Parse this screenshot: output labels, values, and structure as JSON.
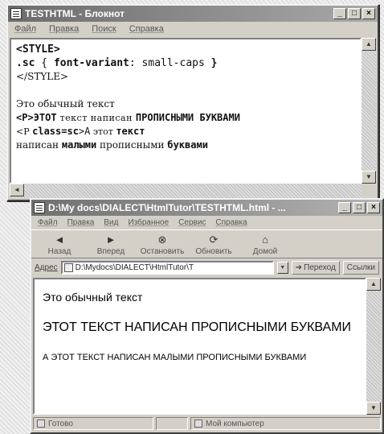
{
  "notepad": {
    "title": "TESTHTML - Блокнот",
    "menu": [
      "Файл",
      "Правка",
      "Поиск",
      "Справка"
    ],
    "lines": [
      "<STYLE>",
      ".sc { font-variant: small-caps }",
      "</STYLE>",
      "Это обычный текст",
      "<P>ЭТОТ текст нaписан ПРОПИСНЫМИ БУКВАМИ",
      "<P class=sc>А этот текст",
      "написан малыми прописными буквами"
    ],
    "line2_parts": {
      "sel": ".sc",
      "open": " { ",
      "prop": "font-variant",
      "colon": ": small-caps ",
      "close": "}"
    },
    "line5_parts": {
      "tag": "<P>",
      "bold": "ЭТОТ",
      "mid": " текст нaписан ",
      "caps": "ПРОПИСНЫМИ БУКВАМИ"
    },
    "line6_parts": {
      "tag": "<P ",
      "cls": "class=sc",
      "rest": ">А",
      "mid": " этот ",
      "bold": "текст"
    },
    "line7_parts": {
      "a": "написан ",
      "b": "малыми",
      "c": " прописными ",
      "d": "буквами"
    }
  },
  "ie": {
    "title": "D:\\My docs\\DIALECT\\HtmlTutor\\TESTHTML.html - ...",
    "menu": [
      "Файл",
      "Правка",
      "Вид",
      "Избранное",
      "Сервис",
      "Справка"
    ],
    "toolbar": [
      {
        "label": "Назад",
        "icon": "back-arrow-icon",
        "glyph": "◄"
      },
      {
        "label": "Вперед",
        "icon": "forward-arrow-icon",
        "glyph": "►"
      },
      {
        "label": "Остановить",
        "icon": "stop-icon",
        "glyph": "⊗"
      },
      {
        "label": "Обновить",
        "icon": "refresh-icon",
        "glyph": "⟳"
      },
      {
        "label": "Домой",
        "icon": "home-icon",
        "glyph": "⌂"
      }
    ],
    "address_label": "Адрес",
    "address_value": "D:\\Mydocs\\DIALECT\\HtmlTutor\\T",
    "go_label": "Переход",
    "links_label": "Ссылки",
    "content": {
      "p1": "Это обычный текст",
      "p2": "ЭТОТ ТЕКСТ НАПИСАН ПРОПИСНЫМИ БУКВАМИ",
      "p3": "А ЭТОТ ТЕКСТ НАПИСАН МАЛЫМИ ПРОПИСНЫМИ БУКВАМИ"
    },
    "status": {
      "ready": "Готово",
      "zone": "Мой компьютер"
    }
  }
}
